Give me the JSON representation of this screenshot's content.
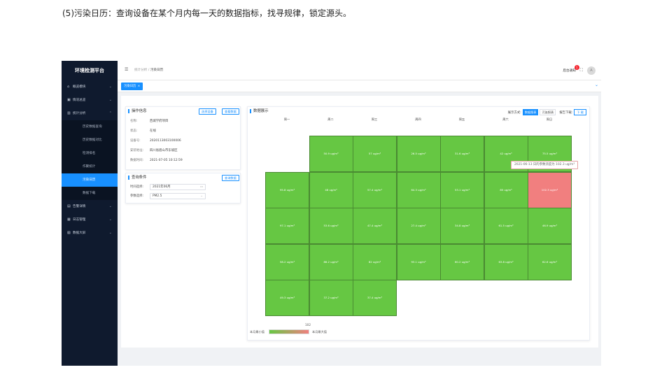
{
  "doc_heading": "(5)污染日历：查询设备在某个月内每一天的数据指标，找寻规律，锁定源头。",
  "sidebar": {
    "brand": "环境检测平台",
    "items": [
      {
        "label": "概览模块",
        "icon": "home-icon",
        "chevron": "⌄"
      },
      {
        "label": "情况总览",
        "icon": "monitor-icon",
        "chevron": "⌄"
      },
      {
        "label": "统计分析",
        "icon": "chart-icon",
        "chevron": "⌃"
      },
      {
        "label": "告警详情",
        "icon": "alarm-icon",
        "chevron": "⌄"
      },
      {
        "label": "日志管理",
        "icon": "log-icon",
        "chevron": "⌄"
      },
      {
        "label": "数据大屏",
        "icon": "screen-icon",
        "chevron": "⌄"
      }
    ],
    "sub_items": [
      "历史数据查询",
      "历史数据对比",
      "检测排名",
      "作聚统计",
      "污染日历",
      "数据下载"
    ],
    "active_sub": "污染日历"
  },
  "header": {
    "menu_glyph": "☰",
    "breadcrumb": [
      "统计分析",
      "/",
      "污染日历"
    ],
    "notice_label": "后台通知",
    "notice_count": "1",
    "fullscreen_glyph": "⛶",
    "avatar_glyph": "A"
  },
  "tags": {
    "active_tag": "污染日历",
    "close_glyph": "×",
    "chevron": "⌄"
  },
  "op_info": {
    "title": "操作信息",
    "select_device_btn": "选择设备",
    "view_data_btn": "查看数据",
    "rows": [
      {
        "key": "名称:",
        "value": "西城学府项目"
      },
      {
        "key": "状态:",
        "value": "在线"
      },
      {
        "key": "设备号:",
        "value": "2020113003100006"
      },
      {
        "key": "安装地址:",
        "value": "四川省眉山市东坡区"
      },
      {
        "key": "数据时间:",
        "value": "2021-07-05 10:12:59"
      }
    ]
  },
  "query": {
    "title": "查询条件",
    "query_btn": "查询数据",
    "time_label": "时间选择:",
    "time_value": "2021年06月",
    "time_icon": "▭",
    "param_label": "参数选择:",
    "param_value": "PM2.5",
    "param_icon": "⌄"
  },
  "display": {
    "title": "数据展示",
    "mode_label": "展示方式:",
    "mode_options": [
      "数据图表",
      "污染报表"
    ],
    "active_mode": "数据图表",
    "report_label": "报告下载:",
    "download_btn": "下 载"
  },
  "calendar": {
    "weekdays": [
      "周一",
      "周二",
      "周三",
      "周四",
      "周五",
      "周六",
      "周日"
    ],
    "weeks": [
      [
        "",
        "50.9 ug/m³",
        "57 ug/m³",
        "26.5 ug/m³",
        "31.6 ug/m³",
        "42 ug/m³",
        "75.5 ug/m³"
      ],
      [
        "95.8 ug/m³",
        "48 ug/m³",
        "57.4 ug/m³",
        "64.3 ug/m³",
        "53.1 ug/m³",
        "85 ug/m³",
        "102.3 ug/m³"
      ],
      [
        "97.1 ug/m³",
        "53.6 ug/m³",
        "47.4 ug/m³",
        "27.4 ug/m³",
        "34.8 ug/m³",
        "61.5 ug/m³",
        "46.9 ug/m³"
      ],
      [
        "58.2 ug/m³",
        "86.2 ug/m³",
        "82 ug/m³",
        "93.1 ug/m³",
        "60.2 ug/m³",
        "63.8 ug/m³",
        "62.6 ug/m³"
      ],
      [
        "49.3 ug/m³",
        "37.2 ug/m³",
        "37.4 ug/m³",
        "",
        "",
        "",
        ""
      ]
    ],
    "peak_value": "102.3 ug/m³",
    "tooltip": "2021-06-13 日的参数浓度为 102.3 ug/m³",
    "legend_min_label": "本月最小值",
    "legend_max_label": "本月最大值",
    "legend_value": "102",
    "colors": {
      "normal": "#66c743",
      "peak": "#f17f7f"
    }
  }
}
